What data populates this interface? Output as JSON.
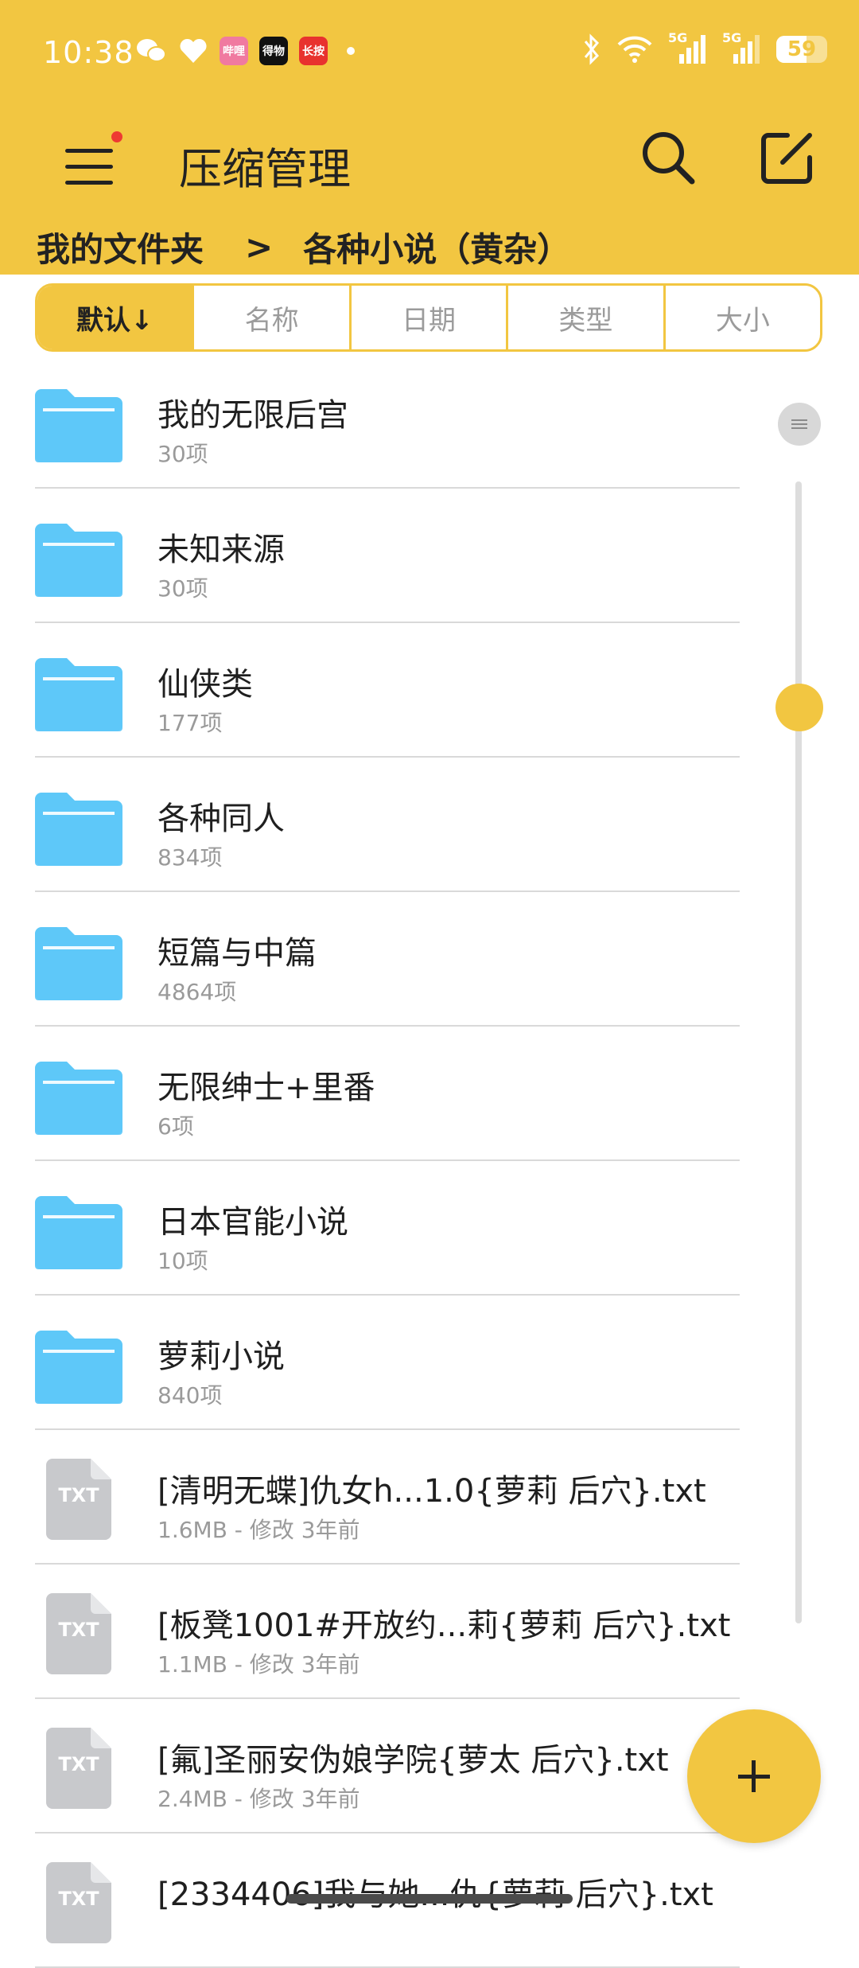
{
  "colors": {
    "accent": "#f2c641",
    "folder": "#5ec8f8",
    "txt_icon": "#c8c9cc",
    "menu_dot": "#ee3a32"
  },
  "status_bar": {
    "time": "10:38",
    "battery": "59",
    "battery_level": 0.59,
    "network_1": "5G",
    "network_2": "5G",
    "app_badge_1": "哔哩",
    "app_badge_2": "得物",
    "app_badge_3": "长按"
  },
  "app_bar": {
    "title": "压缩管理"
  },
  "breadcrumb": {
    "root": "我的文件夹",
    "separator": ">",
    "current": "各种小说（黄杂）"
  },
  "sort_tabs": [
    "默认↓",
    "名称",
    "日期",
    "类型",
    "大小"
  ],
  "items": [
    {
      "type": "folder",
      "name": "我的无限后宫",
      "meta": "30项"
    },
    {
      "type": "folder",
      "name": "未知来源",
      "meta": "30项"
    },
    {
      "type": "folder",
      "name": "仙侠类",
      "meta": "177项"
    },
    {
      "type": "folder",
      "name": "各种同人",
      "meta": "834项"
    },
    {
      "type": "folder",
      "name": "短篇与中篇",
      "meta": "4864项"
    },
    {
      "type": "folder",
      "name": "无限绅士+里番",
      "meta": "6项"
    },
    {
      "type": "folder",
      "name": "日本官能小说",
      "meta": "10项"
    },
    {
      "type": "folder",
      "name": "萝莉小说",
      "meta": "840项"
    },
    {
      "type": "file",
      "icon_label": "TXT",
      "name": "[清明无蝶]仇女h...1.0{萝莉 后穴}.txt",
      "meta": "1.6MB - 修改 3年前"
    },
    {
      "type": "file",
      "icon_label": "TXT",
      "name": "[板凳1001#开放约...莉{萝莉 后穴}.txt",
      "meta": "1.1MB - 修改 3年前"
    },
    {
      "type": "file",
      "icon_label": "TXT",
      "name": "[氟]圣丽安伪娘学院{萝太 后穴}.txt",
      "meta": "2.4MB - 修改 3年前"
    },
    {
      "type": "file",
      "icon_label": "TXT",
      "name": "[2334406]我与她...仇{萝莉 后穴}.txt",
      "meta": ""
    }
  ]
}
